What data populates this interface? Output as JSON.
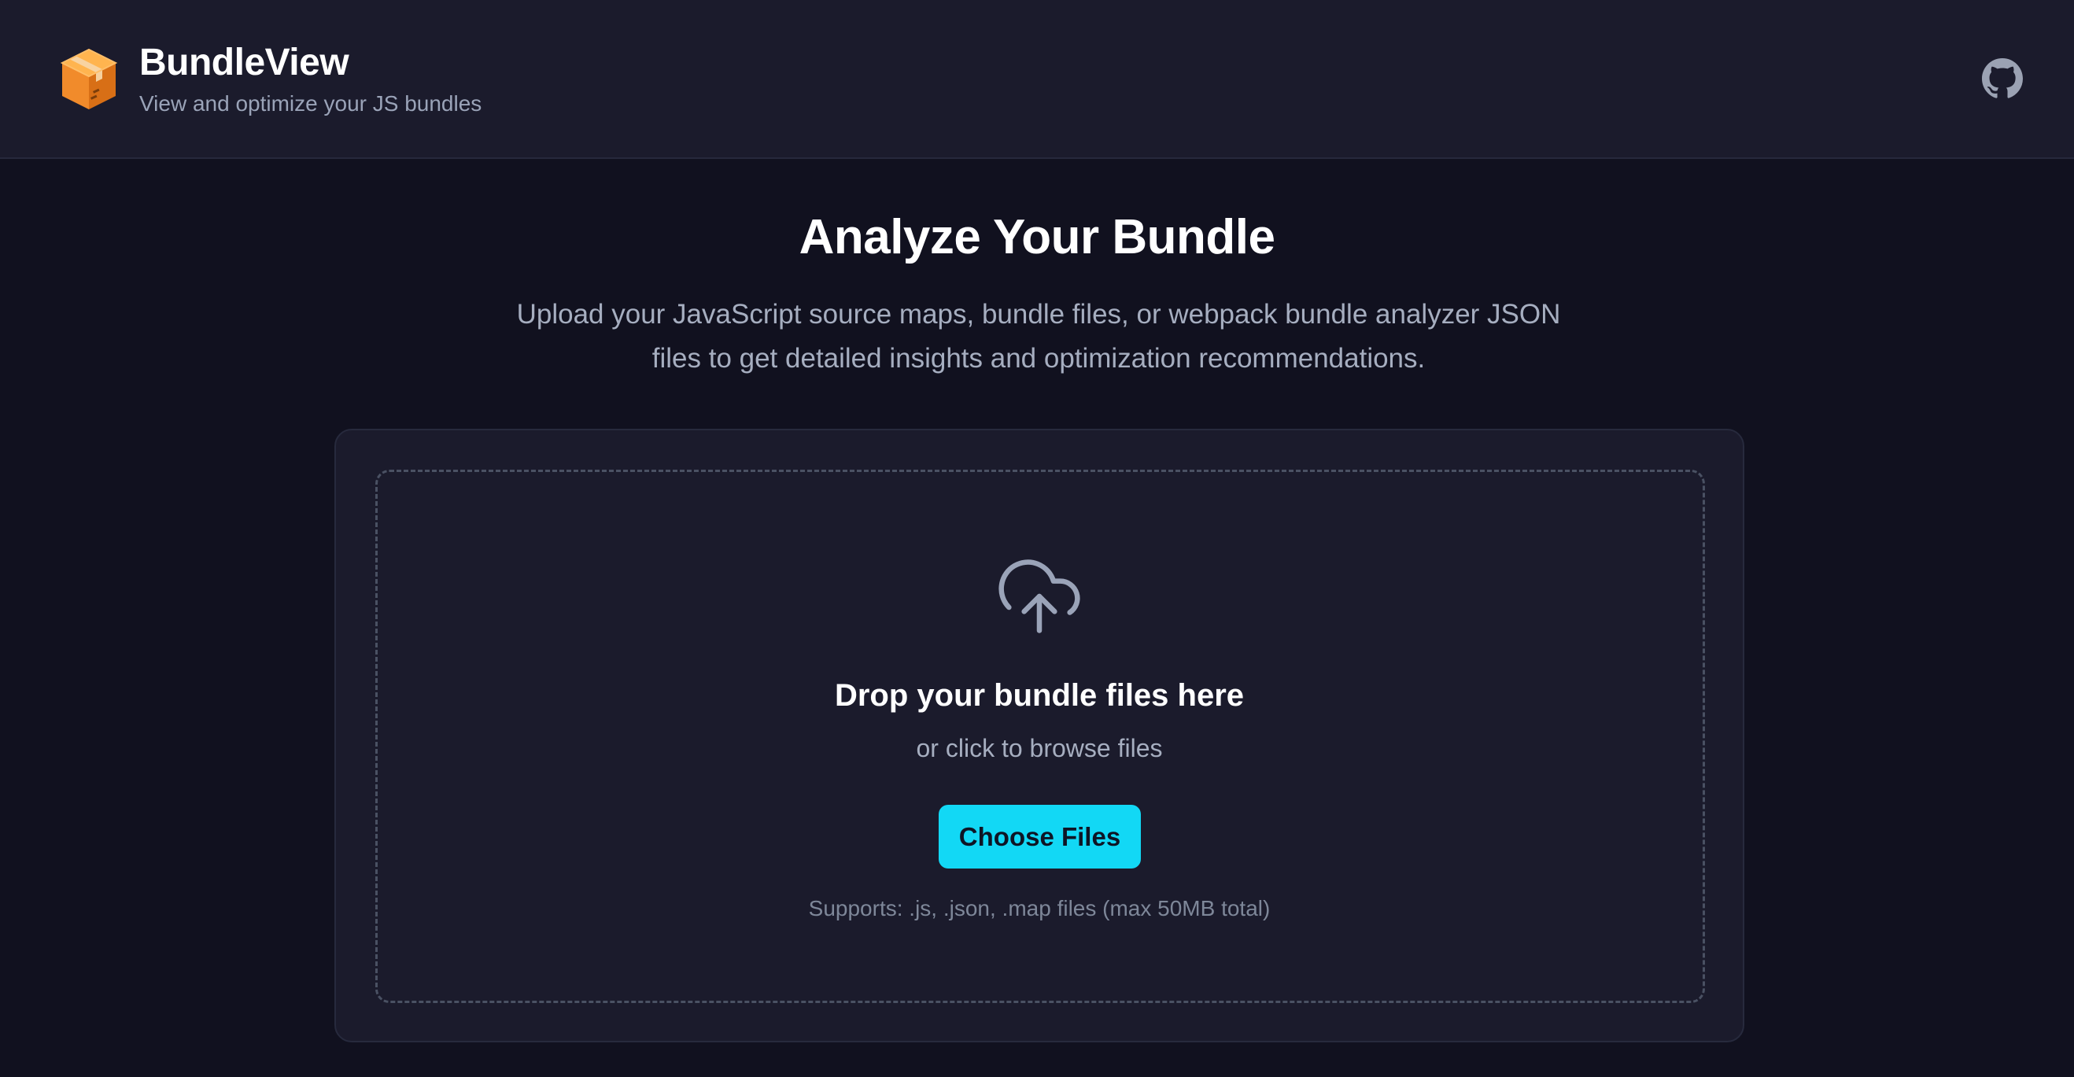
{
  "header": {
    "title": "BundleView",
    "subtitle": "View and optimize your JS bundles",
    "logo_icon": "package-box-icon",
    "github_icon": "github-icon"
  },
  "hero": {
    "title": "Analyze Your Bundle",
    "description": "Upload your JavaScript source maps, bundle files, or webpack bundle analyzer JSON files to get detailed insights and optimization recommendations."
  },
  "upload": {
    "icon": "cloud-upload-icon",
    "title": "Drop your bundle files here",
    "hint": "or click to browse files",
    "button_label": "Choose Files",
    "supports": "Supports: .js, .json, .map files (max 50MB total)"
  },
  "colors": {
    "background": "#11111f",
    "header_background": "#1b1b2c",
    "card_background": "#1b1b2c",
    "accent": "#12d8f5",
    "logo": "#f28c28"
  }
}
